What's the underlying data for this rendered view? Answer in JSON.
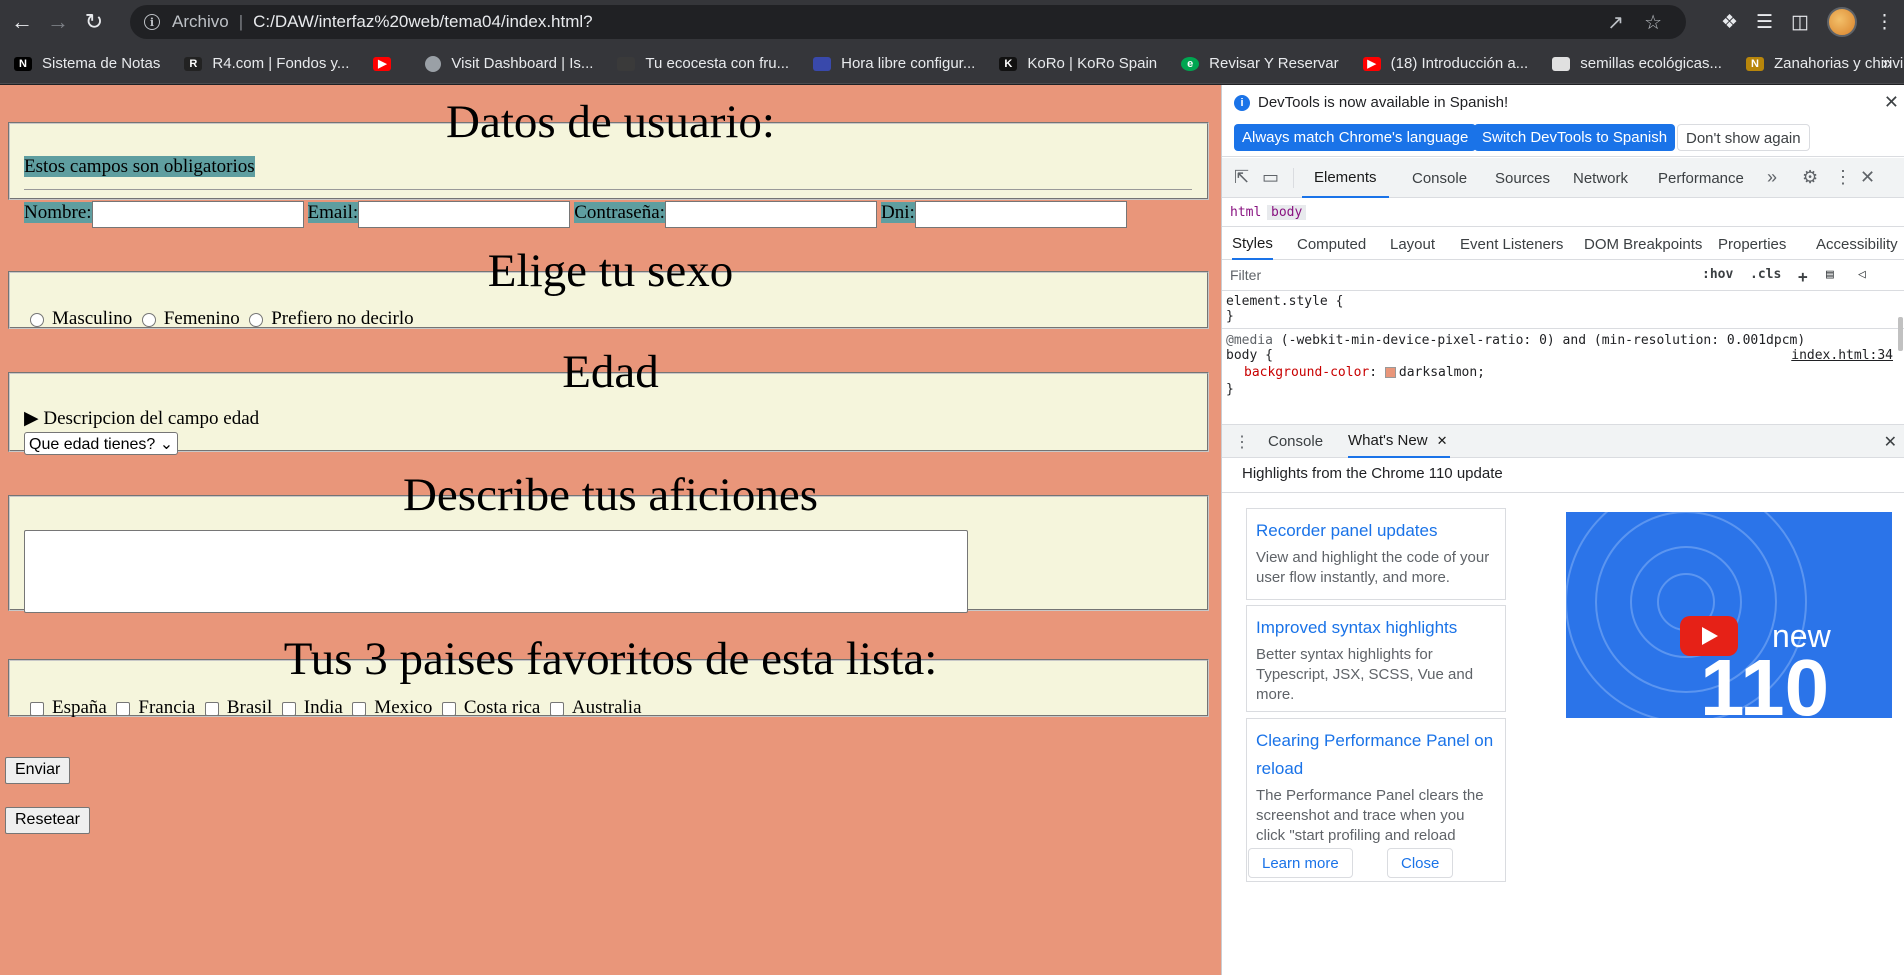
{
  "browser": {
    "url_scheme": "Archivo",
    "url": "C:/DAW/interfaz%20web/tema04/index.html?",
    "bookmarks": [
      {
        "label": "Sistema de Notas",
        "color": "#000000"
      },
      {
        "label": "R4.com | Fondos y...",
        "color": "#222222"
      },
      {
        "label": "",
        "color": "#ff0000"
      },
      {
        "label": "Visit Dashboard | Is...",
        "color": "#9aa0a6"
      },
      {
        "label": "Tu ecocesta con fru...",
        "color": "#3a3a3a"
      },
      {
        "label": "Hora libre configur...",
        "color": "#3949ab"
      },
      {
        "label": "KoRo | KoRo Spain",
        "color": "#111111"
      },
      {
        "label": "Revisar Y Reservar",
        "color": "#00a651"
      },
      {
        "label": "(18) Introducción a...",
        "color": "#ff0000"
      },
      {
        "label": "semillas ecológicas...",
        "color": "#e0e0e0"
      },
      {
        "label": "Zanahorias y chirivi...",
        "color": "#b8860b"
      }
    ]
  },
  "page": {
    "background": "#e9967a",
    "fieldset_bg": "#f5f5dc",
    "highlight": "#5f9ea0",
    "user_section": {
      "legend": "Datos de usuario:",
      "notice": "Estos campos son obligatorios",
      "fields": [
        "Nombre:",
        "Email:",
        "Contraseña:",
        "Dni:"
      ]
    },
    "sex_section": {
      "legend": "Elige tu sexo",
      "options": [
        "Masculino",
        "Femenino",
        "Prefiero no decirlo"
      ]
    },
    "age_section": {
      "legend": "Edad",
      "details_summary": "Descripcion del campo edad",
      "select_value": "Que edad tienes?"
    },
    "hobbies_section": {
      "legend": "Describe tus aficiones"
    },
    "countries_section": {
      "legend": "Tus 3 paises favoritos de esta lista:",
      "options": [
        "España",
        "Francia",
        "Brasil",
        "India",
        "Mexico",
        "Costa rica",
        "Australia"
      ]
    },
    "submit_label": "Enviar",
    "reset_label": "Resetear"
  },
  "devtools": {
    "info_text": "DevTools is now available in Spanish!",
    "btn_match": "Always match Chrome's language",
    "btn_switch": "Switch DevTools to Spanish",
    "btn_dont_show": "Don't show again",
    "main_tabs": [
      "Elements",
      "Console",
      "Sources",
      "Network",
      "Performance"
    ],
    "crumbs": [
      "html",
      "body"
    ],
    "sub_tabs": [
      "Styles",
      "Computed",
      "Layout",
      "Event Listeners",
      "DOM Breakpoints",
      "Properties",
      "Accessibility"
    ],
    "filter_placeholder": "Filter",
    "filter_hov": ":hov",
    "filter_cls": ".cls",
    "css": {
      "element_style": "element.style {",
      "close_brace": "}",
      "media_kw": "@media",
      "media_query": " (-webkit-min-device-pixel-ratio: 0) and (min-resolution: 0.001dpcm)",
      "body_sel": "body {",
      "source": "index.html:34",
      "prop_name": "background-color",
      "prop_value": "darksalmon;"
    },
    "drawer_tabs": [
      "Console",
      "What's New"
    ],
    "highlights": "Highlights from the Chrome 110 update",
    "cards": [
      {
        "title": "Recorder panel updates",
        "desc": "View and highlight the code of your user flow instantly, and more."
      },
      {
        "title": "Improved syntax highlights",
        "desc": "Better syntax highlights for Typescript, JSX, SCSS, Vue and more."
      },
      {
        "title": "Clearing Performance Panel on reload",
        "desc": "The Performance Panel clears the screenshot and trace when you click \"start profiling and reload page\"."
      }
    ],
    "video_new": "new",
    "video_version": "110",
    "learn_more": "Learn more",
    "close": "Close",
    "accent": "#1a73e8"
  }
}
